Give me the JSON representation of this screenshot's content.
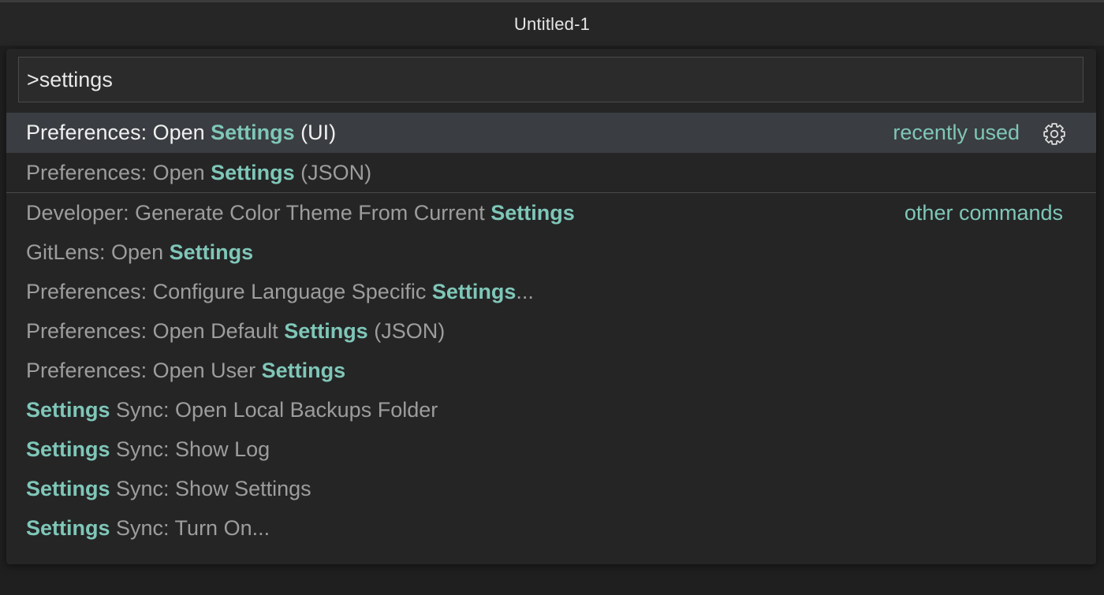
{
  "window": {
    "title": "Untitled-1"
  },
  "command_palette": {
    "input_value": ">settings",
    "highlight_color": "#7fc7b8",
    "recent_group": [
      {
        "parts": [
          {
            "text": "Preferences: Open ",
            "hl": false
          },
          {
            "text": "Settings",
            "hl": true
          },
          {
            "text": " (UI)",
            "hl": false
          }
        ],
        "selected": true,
        "tag": "recently used",
        "icon": "gear-icon"
      },
      {
        "parts": [
          {
            "text": "Preferences: Open ",
            "hl": false
          },
          {
            "text": "Settings",
            "hl": true
          },
          {
            "text": " (JSON)",
            "hl": false
          }
        ]
      }
    ],
    "other_group": [
      {
        "parts": [
          {
            "text": "Developer: Generate Color Theme From Current ",
            "hl": false
          },
          {
            "text": "Settings",
            "hl": true
          }
        ],
        "tag": "other commands"
      },
      {
        "parts": [
          {
            "text": "GitLens: Open ",
            "hl": false
          },
          {
            "text": "Settings",
            "hl": true
          }
        ]
      },
      {
        "parts": [
          {
            "text": "Preferences: Configure Language Specific ",
            "hl": false
          },
          {
            "text": "Settings",
            "hl": true
          },
          {
            "text": "...",
            "hl": false
          }
        ]
      },
      {
        "parts": [
          {
            "text": "Preferences: Open Default ",
            "hl": false
          },
          {
            "text": "Settings",
            "hl": true
          },
          {
            "text": " (JSON)",
            "hl": false
          }
        ]
      },
      {
        "parts": [
          {
            "text": "Preferences: Open User ",
            "hl": false
          },
          {
            "text": "Settings",
            "hl": true
          }
        ]
      },
      {
        "parts": [
          {
            "text": "Settings",
            "hl": true
          },
          {
            "text": " Sync: Open Local Backups Folder",
            "hl": false
          }
        ]
      },
      {
        "parts": [
          {
            "text": "Settings",
            "hl": true
          },
          {
            "text": " Sync: Show Log",
            "hl": false
          }
        ]
      },
      {
        "parts": [
          {
            "text": "Settings",
            "hl": true
          },
          {
            "text": " Sync: Show Settings",
            "hl": false
          }
        ]
      },
      {
        "parts": [
          {
            "text": "Settings",
            "hl": true
          },
          {
            "text": " Sync: Turn On...",
            "hl": false
          }
        ]
      }
    ]
  }
}
